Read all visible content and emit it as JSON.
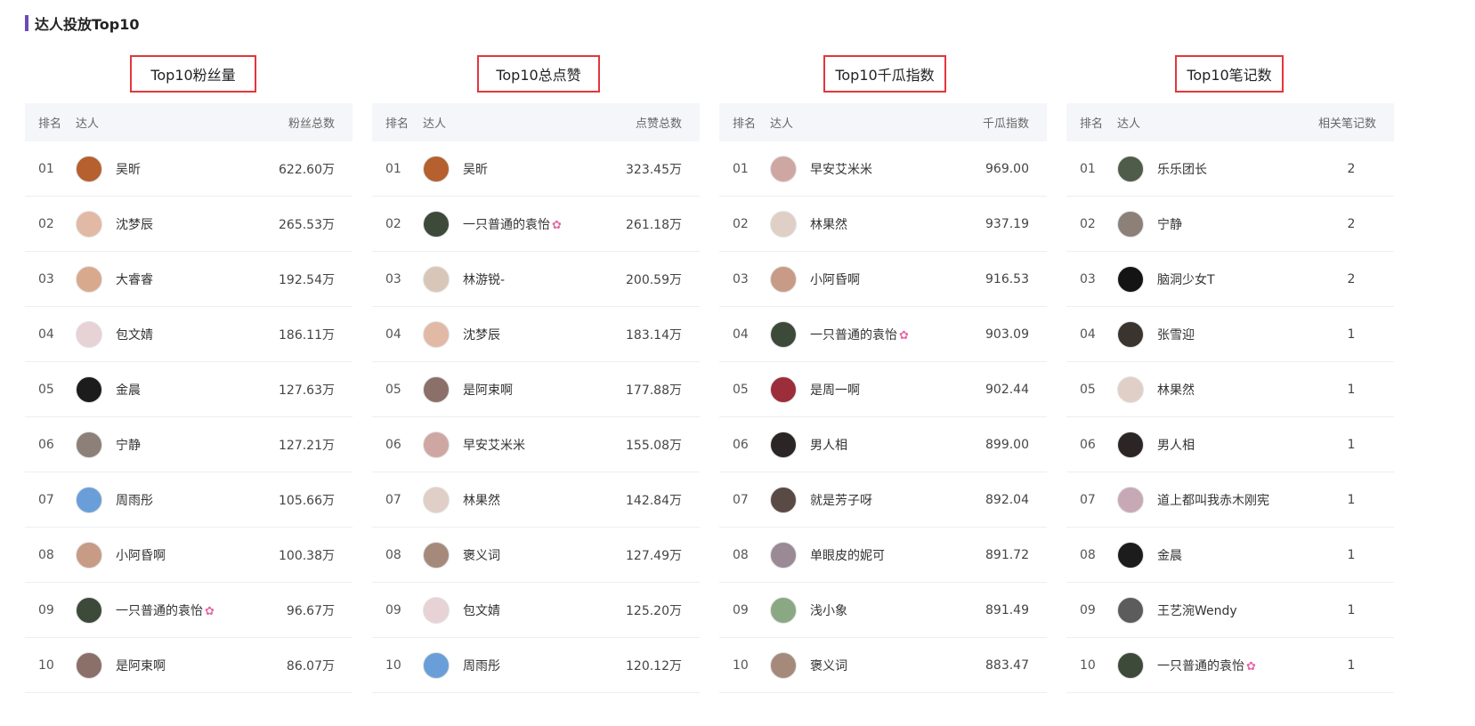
{
  "section": {
    "title": "达人投放Top10"
  },
  "columns": [
    {
      "heading": "Top10粉丝量",
      "headers": {
        "rank": "排名",
        "name": "达人",
        "value": "粉丝总数"
      },
      "rows": [
        {
          "rank": "01",
          "name": "吴昕",
          "value": "622.60万",
          "avatar_color": "#b5602e"
        },
        {
          "rank": "02",
          "name": "沈梦辰",
          "value": "265.53万",
          "avatar_color": "#e2b9a5"
        },
        {
          "rank": "03",
          "name": "大睿睿",
          "value": "192.54万",
          "avatar_color": "#d9a98e"
        },
        {
          "rank": "04",
          "name": "包文婧",
          "value": "186.11万",
          "avatar_color": "#e7d2d6"
        },
        {
          "rank": "05",
          "name": "金晨",
          "value": "127.63万",
          "avatar_color": "#1c1c1c"
        },
        {
          "rank": "06",
          "name": "宁静",
          "value": "127.21万",
          "avatar_color": "#8c8078"
        },
        {
          "rank": "07",
          "name": "周雨彤",
          "value": "105.66万",
          "avatar_color": "#6a9ed8"
        },
        {
          "rank": "08",
          "name": "小阿昏啊",
          "value": "100.38万",
          "avatar_color": "#c79b86"
        },
        {
          "rank": "09",
          "name": "一只普通的袁怡",
          "value": "96.67万",
          "avatar_color": "#3d4a3a",
          "flower": true
        },
        {
          "rank": "10",
          "name": "是阿束啊",
          "value": "86.07万",
          "avatar_color": "#8a7068"
        }
      ]
    },
    {
      "heading": "Top10总点赞",
      "headers": {
        "rank": "排名",
        "name": "达人",
        "value": "点赞总数"
      },
      "rows": [
        {
          "rank": "01",
          "name": "吴昕",
          "value": "323.45万",
          "avatar_color": "#b5602e"
        },
        {
          "rank": "02",
          "name": "一只普通的袁怡",
          "value": "261.18万",
          "avatar_color": "#3d4a3a",
          "flower": true
        },
        {
          "rank": "03",
          "name": "林游锐-",
          "value": "200.59万",
          "avatar_color": "#d8c7b9"
        },
        {
          "rank": "04",
          "name": "沈梦辰",
          "value": "183.14万",
          "avatar_color": "#e2b9a5"
        },
        {
          "rank": "05",
          "name": "是阿束啊",
          "value": "177.88万",
          "avatar_color": "#8a7068"
        },
        {
          "rank": "06",
          "name": "早安艾米米",
          "value": "155.08万",
          "avatar_color": "#cfa7a2"
        },
        {
          "rank": "07",
          "name": "林果然",
          "value": "142.84万",
          "avatar_color": "#e0cfc7"
        },
        {
          "rank": "08",
          "name": "褒义词",
          "value": "127.49万",
          "avatar_color": "#a58a7c"
        },
        {
          "rank": "09",
          "name": "包文婧",
          "value": "125.20万",
          "avatar_color": "#e7d2d6"
        },
        {
          "rank": "10",
          "name": "周雨彤",
          "value": "120.12万",
          "avatar_color": "#6a9ed8"
        }
      ]
    },
    {
      "heading": "Top10千瓜指数",
      "headers": {
        "rank": "排名",
        "name": "达人",
        "value": "千瓜指数"
      },
      "rows": [
        {
          "rank": "01",
          "name": "早安艾米米",
          "value": "969.00",
          "avatar_color": "#cfa7a2"
        },
        {
          "rank": "02",
          "name": "林果然",
          "value": "937.19",
          "avatar_color": "#e0cfc7"
        },
        {
          "rank": "03",
          "name": "小阿昏啊",
          "value": "916.53",
          "avatar_color": "#c79b86"
        },
        {
          "rank": "04",
          "name": "一只普通的袁怡",
          "value": "903.09",
          "avatar_color": "#3d4a3a",
          "flower": true
        },
        {
          "rank": "05",
          "name": "是周一啊",
          "value": "902.44",
          "avatar_color": "#9c2d3a"
        },
        {
          "rank": "06",
          "name": "男人相",
          "value": "899.00",
          "avatar_color": "#2b2525"
        },
        {
          "rank": "07",
          "name": "就是芳子呀",
          "value": "892.04",
          "avatar_color": "#5a4a46"
        },
        {
          "rank": "08",
          "name": "单眼皮的妮可",
          "value": "891.72",
          "avatar_color": "#9a8a96"
        },
        {
          "rank": "09",
          "name": "浅小象",
          "value": "891.49",
          "avatar_color": "#8aa884"
        },
        {
          "rank": "10",
          "name": "褒义词",
          "value": "883.47",
          "avatar_color": "#a58a7c"
        }
      ]
    },
    {
      "heading": "Top10笔记数",
      "headers": {
        "rank": "排名",
        "name": "达人",
        "value": "相关笔记数"
      },
      "rows": [
        {
          "rank": "01",
          "name": "乐乐团长",
          "value": "2",
          "avatar_color": "#4f5c4a"
        },
        {
          "rank": "02",
          "name": "宁静",
          "value": "2",
          "avatar_color": "#8c8078"
        },
        {
          "rank": "03",
          "name": "脑洞少女T",
          "value": "2",
          "avatar_color": "#141414"
        },
        {
          "rank": "04",
          "name": "张雪迎",
          "value": "1",
          "avatar_color": "#3a332e"
        },
        {
          "rank": "05",
          "name": "林果然",
          "value": "1",
          "avatar_color": "#e0cfc7"
        },
        {
          "rank": "06",
          "name": "男人相",
          "value": "1",
          "avatar_color": "#2b2525"
        },
        {
          "rank": "07",
          "name": "道上都叫我赤木刚宪",
          "value": "1",
          "avatar_color": "#c7a8b5"
        },
        {
          "rank": "08",
          "name": "金晨",
          "value": "1",
          "avatar_color": "#1c1c1c"
        },
        {
          "rank": "09",
          "name": "王艺涴Wendy",
          "value": "1",
          "avatar_color": "#5c5c5c"
        },
        {
          "rank": "10",
          "name": "一只普通的袁怡",
          "value": "1",
          "avatar_color": "#3d4a3a",
          "flower": true
        }
      ]
    }
  ]
}
